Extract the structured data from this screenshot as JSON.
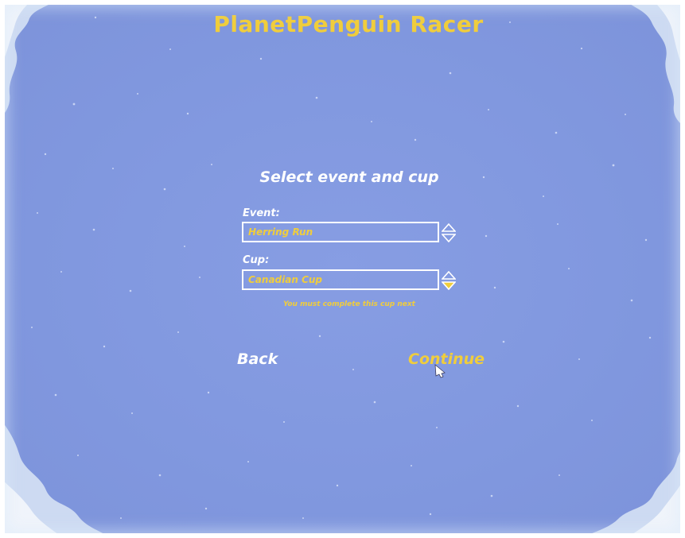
{
  "app": {
    "title": "PlanetPenguin Racer"
  },
  "screen": {
    "heading": "Select event and cup",
    "event": {
      "label": "Event:",
      "value": "Herring Run"
    },
    "cup": {
      "label": "Cup:",
      "value": "Canadian Cup"
    },
    "hint": "You must complete this cup next",
    "buttons": {
      "back": "Back",
      "continue": "Continue"
    }
  },
  "colors": {
    "background": "#8198e0",
    "accent": "#f0cd3c",
    "text": "#ffffff"
  },
  "icons": {
    "event_spinner": "up-down-arrows-icon",
    "cup_spinner": "up-down-arrows-icon",
    "cursor": "penguin-pointer-icon"
  }
}
